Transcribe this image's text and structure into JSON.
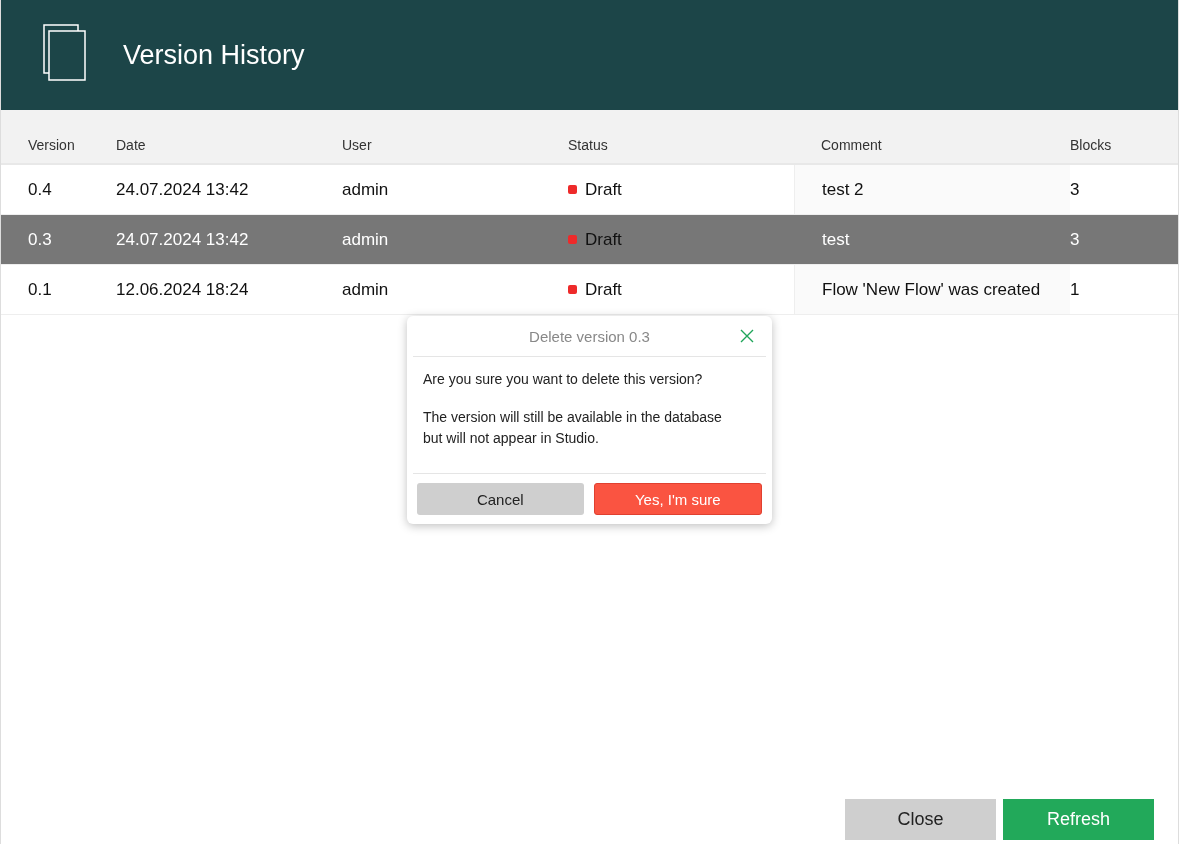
{
  "window": {
    "title": "Version History"
  },
  "table": {
    "columns": [
      "Version",
      "Date",
      "User",
      "Status",
      "Comment",
      "Blocks"
    ],
    "rows": [
      {
        "version": "0.4",
        "date": "24.07.2024 13:42",
        "user": "admin",
        "status": "Draft",
        "color": "#ee2a2a",
        "comment": "test 2",
        "blocks": "3",
        "selected": false
      },
      {
        "version": "0.3",
        "date": "24.07.2024 13:42",
        "user": "admin",
        "status": "Draft",
        "color": "#ee2a2a",
        "comment": "test",
        "blocks": "3",
        "selected": true
      },
      {
        "version": "0.1",
        "date": "12.06.2024 18:24",
        "user": "admin",
        "status": "Draft",
        "color": "#ee2a2a",
        "comment": "Flow 'New Flow' was created",
        "blocks": "1",
        "selected": false
      }
    ]
  },
  "dialog": {
    "title": "Delete version 0.3",
    "question": "Are you sure you want to delete this version?",
    "message": "The version will still be available in the database but will not appear in Studio.",
    "buttons": [
      {
        "label": "Cancel",
        "kind": "secondary"
      },
      {
        "label": "Yes, I'm sure",
        "kind": "danger"
      }
    ]
  },
  "footer": {
    "buttons": [
      {
        "label": "Close",
        "kind": "secondary"
      },
      {
        "label": "Refresh",
        "kind": "primary"
      }
    ]
  }
}
